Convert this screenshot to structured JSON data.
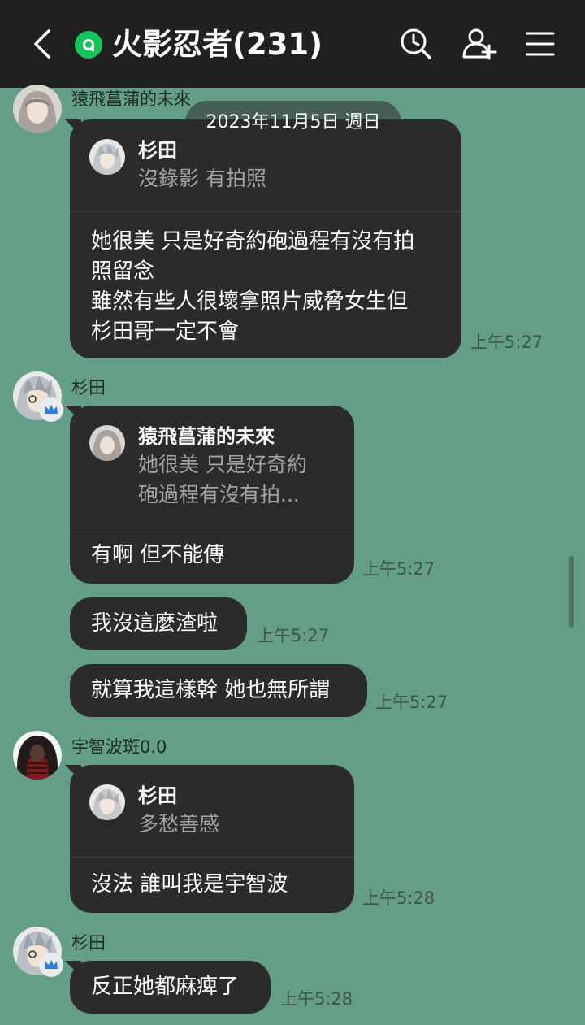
{
  "header": {
    "title": "火影忍者(231)",
    "icons": [
      "back-icon",
      "open-chat-icon",
      "search-icon",
      "add-friend-icon",
      "menu-icon"
    ]
  },
  "date_separator": "2023年11月5日 週日",
  "messages": [
    {
      "sender": "猿飛菖蒲的未來",
      "reply_to": {
        "name": "杉田",
        "text": "沒錄影 有拍照"
      },
      "lines": [
        "她很美 只是好奇約砲過程有沒有拍",
        "照留念",
        "雖然有些人很壞拿照片威脅女生但",
        "杉田哥一定不會"
      ],
      "time": "上午5:27"
    },
    {
      "sender": "杉田",
      "reply_to": {
        "name": "猿飛菖蒲的未來",
        "text_lines": [
          "她很美 只是好奇約",
          "砲過程有沒有拍..."
        ]
      },
      "text": "有啊 但不能傳",
      "time": "上午5:27"
    },
    {
      "text": "我沒這麼渣啦",
      "time": "上午5:27"
    },
    {
      "text": "就算我這樣幹 她也無所謂",
      "time": "上午5:27"
    },
    {
      "sender": "宇智波斑0.0",
      "reply_to": {
        "name": "杉田",
        "text": "多愁善感"
      },
      "text": "沒法 誰叫我是宇智波",
      "time": "上午5:28"
    },
    {
      "sender": "杉田",
      "text": "反正她都麻痺了",
      "time": "上午5:28"
    }
  ],
  "colors": {
    "chat_bg": "#649e87",
    "bubble": "#2b2b2b",
    "header": "#202020",
    "open_chat_badge": "#15c55a"
  }
}
